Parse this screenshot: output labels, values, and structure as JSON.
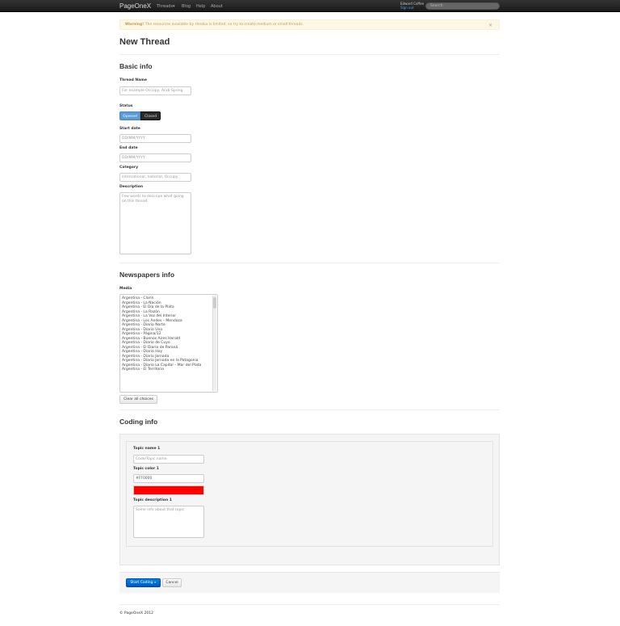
{
  "navbar": {
    "brand": "PageOneX",
    "items": [
      "Threads",
      "Blog",
      "Help",
      "About"
    ],
    "threads_caret": "▾",
    "user_name": "Edward Coffee",
    "sign_out": "Sign out",
    "search_placeholder": "Search"
  },
  "alert": {
    "strong": "Warning!",
    "text": " The resources available by Heroku is limited, so try to create medium or small threads.",
    "close": "×"
  },
  "page_title": "New Thread",
  "basic_info": {
    "heading": "Basic info",
    "thread_name_label": "Thread Name",
    "thread_name_placeholder": "For example Occupy, Arab Spring",
    "status_label": "Status",
    "status_opened": "Opened",
    "status_closed": "Closed",
    "start_date_label": "Start date",
    "start_date_placeholder": "DD/MM/YYYY",
    "end_date_label": "End date",
    "end_date_placeholder": "DD/MM/YYYY",
    "category_label": "Category",
    "category_placeholder": "international, national, Occupy",
    "description_label": "Description",
    "description_placeholder": "Few words to descripe what going on this thread"
  },
  "newspapers_info": {
    "heading": "Newspapers info",
    "media_label": "Media",
    "media": [
      "Argentina - Clarín",
      "Argentina - La Nación",
      "Argentina - El Día de la Plata",
      "Argentina - La Razón",
      "Argentina - La Voz del Interior",
      "Argentina - Los Andes – Mendoza",
      "Argentina - Diario Norte",
      "Argentina - Diario Uno",
      "Argentina - Página/12",
      "Argentina - Buenos Aires Herald",
      "Argentina - Diario de Cuyo",
      "Argentina - El Diario de Paraná",
      "Argentina - Diario Hoy",
      "Argentina - Diario Jornada",
      "Argentina - Diario Jornada en la Patagonia",
      "Argentina - Diario La Capital – Mar del Plata",
      "Argentina - El Territorio"
    ],
    "clear_button": "Clear all choices"
  },
  "coding_info": {
    "heading": "Coding info",
    "topic_name_label": "Topic name 1",
    "topic_name_placeholder": "Code/Topic name",
    "topic_color_label": "Topic color 1",
    "topic_color_value": "#FF0000",
    "topic_color": "#ff0000",
    "topic_desc_label": "Topic description 1",
    "topic_desc_placeholder": "Some info about that topic"
  },
  "actions": {
    "start_coding": "Start Coding »",
    "cancel": "Cancel"
  },
  "footer": "© PageOneX 2012"
}
